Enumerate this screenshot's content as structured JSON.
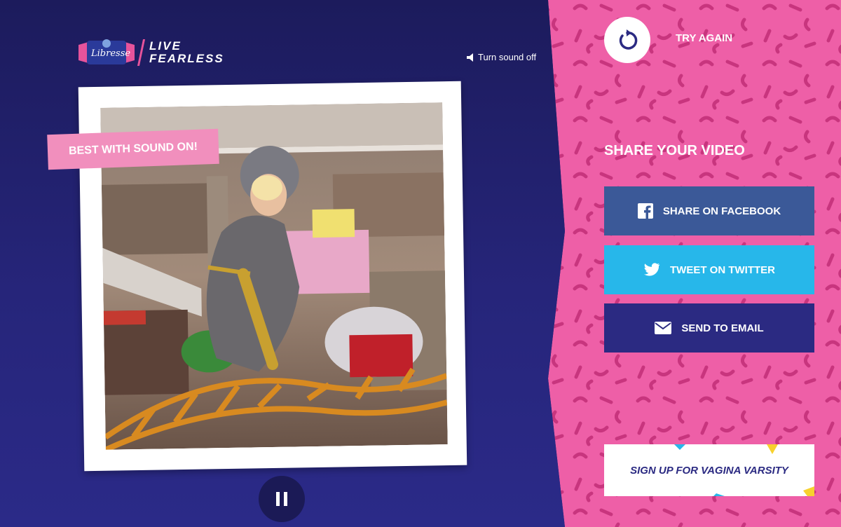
{
  "brand": {
    "logo_text": "Libresse",
    "tagline_line1": "LIVE",
    "tagline_line2": "FEARLESS"
  },
  "sound_toggle": {
    "label": "Turn sound off"
  },
  "video": {
    "banner": "BEST WITH SOUND ON!"
  },
  "try_again": {
    "label": "TRY AGAIN"
  },
  "share": {
    "title": "SHARE YOUR VIDEO",
    "facebook_label": "SHARE ON FACEBOOK",
    "twitter_label": "TWEET ON TWITTER",
    "email_label": "SEND TO EMAIL"
  },
  "signup": {
    "label": "SIGN UP FOR VAGINA VARSITY"
  },
  "colors": {
    "accent_pink": "#e6539b",
    "navy": "#1e1d63",
    "facebook": "#3b5998",
    "twitter": "#27b7ea",
    "email": "#2b2a82"
  }
}
